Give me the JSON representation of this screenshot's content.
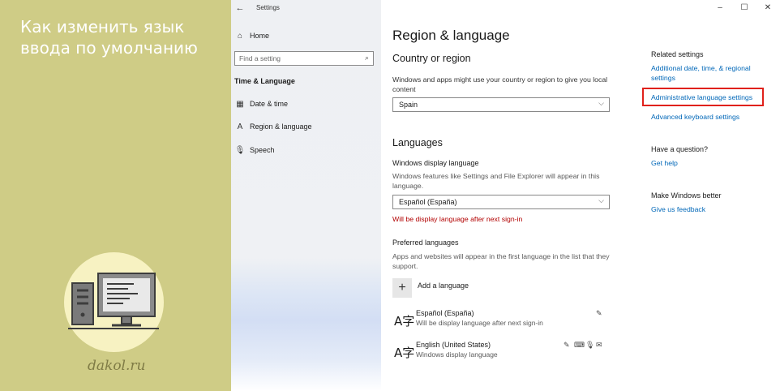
{
  "banner": {
    "title": "Как изменить язык ввода по умолчанию",
    "site": "dakol.ru"
  },
  "window": {
    "title": "Settings",
    "controls": {
      "minimize": "–",
      "maximize": "☐",
      "close": "✕"
    }
  },
  "nav": {
    "back_icon": "←",
    "home_label": "Home",
    "home_icon": "⌂",
    "search_placeholder": "Find a setting",
    "search_icon": "⌕",
    "section_label": "Time & Language",
    "items": [
      {
        "label": "Date & time",
        "icon": "▦"
      },
      {
        "label": "Region & language",
        "icon": "A"
      },
      {
        "label": "Speech",
        "icon": "🎙"
      }
    ]
  },
  "content": {
    "page_title": "Region & language",
    "country_heading": "Country or region",
    "country_desc": "Windows and apps might use your country or region to give you local content",
    "country_value": "Spain",
    "languages_heading": "Languages",
    "display_lang_label": "Windows display language",
    "display_lang_desc": "Windows features like Settings and File Explorer will appear in this language.",
    "display_lang_value": "Español (España)",
    "display_lang_warning": "Will be display language after next sign-in",
    "preferred_label": "Preferred languages",
    "preferred_desc": "Apps and websites will appear in the first language in the list that they support.",
    "add_language_label": "Add a language",
    "languages": [
      {
        "name": "Español (España)",
        "sub": "Will be display language after next sign-in",
        "features": [
          "✎"
        ]
      },
      {
        "name": "English (United States)",
        "sub": "Windows display language",
        "features": [
          "✎",
          "⌨",
          "🎙",
          "✉"
        ]
      }
    ],
    "chevron": "⌵",
    "lang_glyph": "A字"
  },
  "related": {
    "heading": "Related settings",
    "links": [
      "Additional date, time, & regional settings",
      "Administrative language settings",
      "Advanced keyboard settings"
    ],
    "question_heading": "Have a question?",
    "help_link": "Get help",
    "better_heading": "Make Windows better",
    "feedback_link": "Give us feedback"
  },
  "colors": {
    "banner_bg": "#cfcc86",
    "link": "#0067b8",
    "warning": "#b20000",
    "highlight_border": "#e0211b"
  }
}
